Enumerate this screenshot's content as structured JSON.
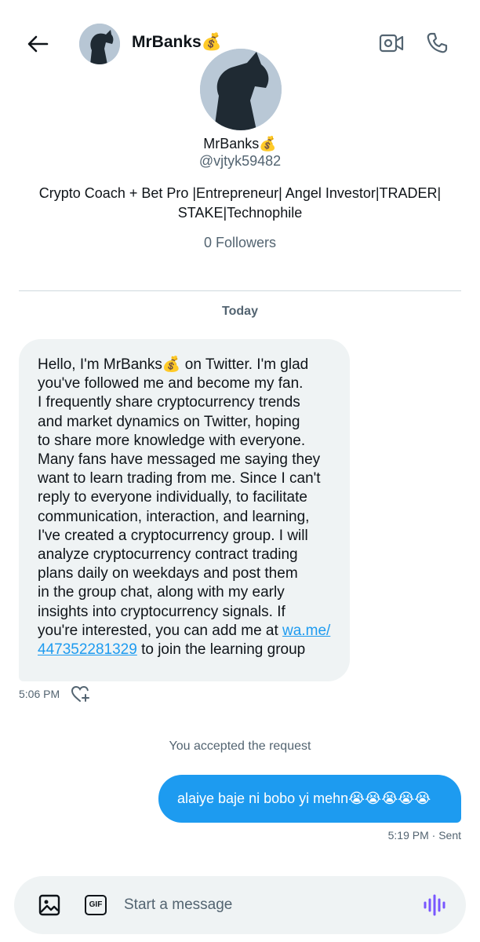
{
  "header": {
    "back_icon": "back-arrow-icon",
    "avatar_icon": "goat-silhouette-avatar",
    "name": "MrBanks💰",
    "video_icon": "video-call-icon",
    "call_icon": "phone-call-icon"
  },
  "profile": {
    "name": "MrBanks💰",
    "handle": "@vjtyk59482",
    "bio_line1": "Crypto Coach + Bet Pro |Entrepreneur| Angel Investor|TRADER|",
    "bio_line2": "STAKE|Technophile",
    "followers": "0 Followers"
  },
  "conversation": {
    "date_label": "Today",
    "incoming": {
      "lines": [
        "Hello, I'm MrBanks💰 on Twitter. I'm glad",
        "you've followed me and become my fan.",
        "I frequently share cryptocurrency trends",
        "and market dynamics on Twitter, hoping",
        "to share more knowledge with everyone.",
        "Many fans have messaged me saying they",
        "want to learn trading from me. Since I can't",
        "reply to everyone individually, to facilitate",
        "communication, interaction, and learning,",
        "I've created a cryptocurrency group. I will",
        "analyze cryptocurrency contract trading",
        "plans daily on weekdays and post them",
        "in the group chat, along with my early",
        "insights into cryptocurrency signals. If"
      ],
      "line15_prefix": "you're interested, you can add me at ",
      "link_part1": "wa.me/",
      "link_part2": "447352281329",
      "line16_suffix": " to join the learning group",
      "time": "5:06 PM",
      "react_icon": "heart-plus-icon"
    },
    "system_message": "You accepted the request",
    "outgoing": {
      "text": "alaiye baje ni bobo yi mehn😭😭😭😭😭",
      "status": "5:19 PM · Sent"
    }
  },
  "composer": {
    "image_icon": "image-icon",
    "gif_label": "GIF",
    "placeholder": "Start a message",
    "voice_icon": "voice-waveform-icon",
    "accent_color": "#1d9bf0",
    "voice_color": "#7856ff"
  }
}
